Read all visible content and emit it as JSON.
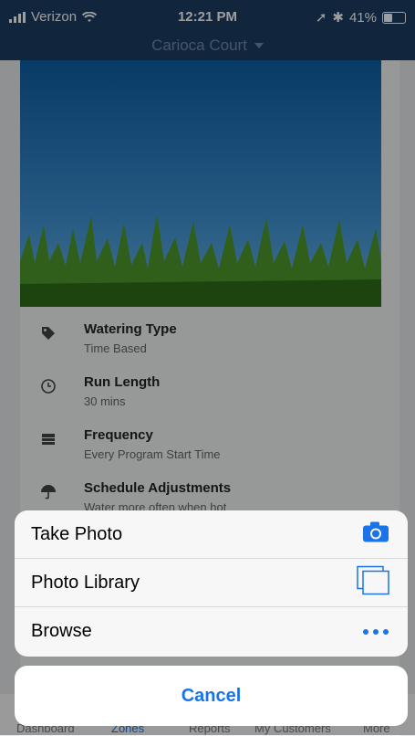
{
  "status": {
    "carrier": "Verizon",
    "time": "12:21 PM",
    "battery": "41%"
  },
  "nav": {
    "title": "Carioca Court"
  },
  "details": [
    {
      "title": "Watering Type",
      "subtitle": "Time Based",
      "icon": "tag-icon"
    },
    {
      "title": "Run Length",
      "subtitle": "30 mins",
      "icon": "clock-icon"
    },
    {
      "title": "Frequency",
      "subtitle": "Every Program Start Time",
      "icon": "calendar-icon"
    },
    {
      "title": "Schedule Adjustments",
      "subtitle": "Water more often when hot",
      "icon": "umbrella-icon"
    }
  ],
  "tabs": [
    {
      "label": "Dashboard"
    },
    {
      "label": "Zones"
    },
    {
      "label": "Reports"
    },
    {
      "label": "My Customers"
    },
    {
      "label": "More"
    }
  ],
  "action_sheet": {
    "items": [
      {
        "label": "Take Photo",
        "icon": "camera-icon"
      },
      {
        "label": "Photo Library",
        "icon": "photo-library-icon"
      },
      {
        "label": "Browse",
        "icon": "more-icon"
      }
    ],
    "cancel_label": "Cancel"
  },
  "colors": {
    "accent": "#1a73e8",
    "navbar": "#1c3d63"
  }
}
